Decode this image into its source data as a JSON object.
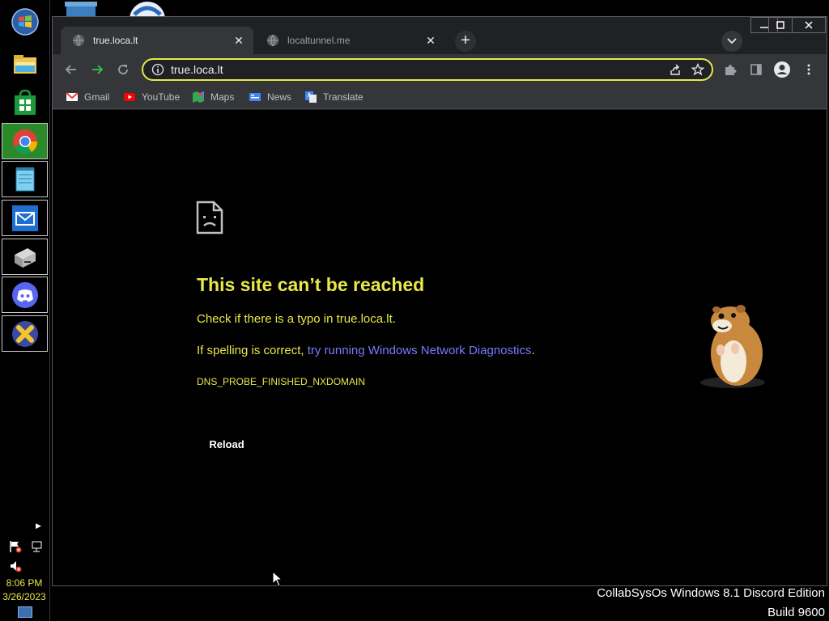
{
  "taskbar": {
    "apps": [
      {
        "name": "start-button",
        "icon": "windows-orb-icon"
      },
      {
        "name": "file-explorer",
        "icon": "folder-icon"
      },
      {
        "name": "store",
        "icon": "store-bag-icon"
      },
      {
        "name": "chrome",
        "icon": "chrome-icon"
      },
      {
        "name": "notepad",
        "icon": "notepad-icon"
      },
      {
        "name": "mail",
        "icon": "mail-icon"
      },
      {
        "name": "drive",
        "icon": "disk-drive-icon"
      },
      {
        "name": "discord",
        "icon": "discord-icon"
      },
      {
        "name": "xplorer",
        "icon": "x-icon"
      }
    ],
    "tray": {
      "time": "8:06 PM",
      "date": "3/26/2023",
      "icons": [
        "flag-icon",
        "network-icon",
        "muted-speaker-icon",
        "show-desktop-icon"
      ]
    }
  },
  "browser": {
    "tabs": [
      {
        "title": "true.loca.lt",
        "active": true
      },
      {
        "title": "localtunnel.me",
        "active": false
      }
    ],
    "omnibox": {
      "url": "true.loca.lt"
    },
    "bookmarks": [
      {
        "label": "Gmail",
        "icon": "gmail-icon"
      },
      {
        "label": "YouTube",
        "icon": "youtube-icon"
      },
      {
        "label": "Maps",
        "icon": "maps-icon"
      },
      {
        "label": "News",
        "icon": "news-icon"
      },
      {
        "label": "Translate",
        "icon": "translate-icon"
      }
    ]
  },
  "error_page": {
    "title": "This site can’t be reached",
    "line1": "Check if there is a typo in true.loca.lt.",
    "line2_prefix": "If spelling is correct, ",
    "line2_link": "try running Windows Network Diagnostics",
    "line2_suffix": ".",
    "code": "DNS_PROBE_FINISHED_NXDOMAIN",
    "reload_label": "Reload"
  },
  "desktop": {
    "watermark_line1": "CollabSysOs Windows 8.1 Discord Edition",
    "watermark_line2": "Build 9600"
  },
  "colors": {
    "accent_yellow": "#e8e84a",
    "link_blue": "#7b7bff",
    "chrome_dark": "#202124",
    "chrome_toolbar": "#35363a"
  }
}
